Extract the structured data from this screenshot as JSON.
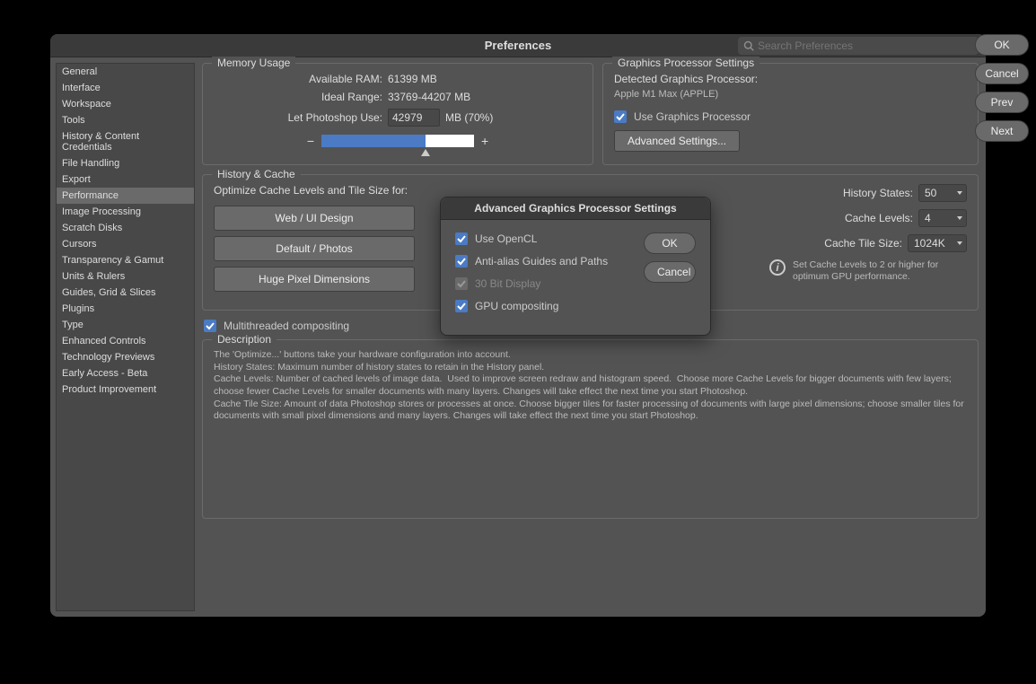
{
  "window": {
    "title": "Preferences",
    "search_placeholder": "Search Preferences"
  },
  "sidebar": {
    "items": [
      "General",
      "Interface",
      "Workspace",
      "Tools",
      "History & Content Credentials",
      "File Handling",
      "Export",
      "Performance",
      "Image Processing",
      "Scratch Disks",
      "Cursors",
      "Transparency & Gamut",
      "Units & Rulers",
      "Guides, Grid & Slices",
      "Plugins",
      "Type",
      "Enhanced Controls",
      "Technology Previews",
      "Early Access - Beta",
      "Product Improvement"
    ],
    "selected_index": 7
  },
  "buttons": {
    "ok": "OK",
    "cancel": "Cancel",
    "prev": "Prev",
    "next": "Next"
  },
  "memory": {
    "title": "Memory Usage",
    "available_label": "Available RAM:",
    "available_value": "61399 MB",
    "ideal_label": "Ideal Range:",
    "ideal_value": "33769-44207 MB",
    "use_label": "Let Photoshop Use:",
    "use_value": "42979",
    "use_suffix": "MB (70%)",
    "minus": "−",
    "plus": "+"
  },
  "gpu": {
    "title": "Graphics Processor Settings",
    "detected_label": "Detected Graphics Processor:",
    "detected_value": "Apple M1 Max (APPLE)",
    "use_gpu": "Use Graphics Processor",
    "advanced_btn": "Advanced Settings..."
  },
  "history": {
    "title": "History & Cache",
    "optimize_label": "Optimize Cache Levels and Tile Size for:",
    "btn_web": "Web / UI Design",
    "btn_default": "Default / Photos",
    "btn_huge": "Huge Pixel Dimensions",
    "history_states_label": "History States:",
    "history_states_value": "50",
    "cache_levels_label": "Cache Levels:",
    "cache_levels_value": "4",
    "cache_tile_label": "Cache Tile Size:",
    "cache_tile_value": "1024K",
    "info": "Set Cache Levels to 2 or higher for optimum GPU performance."
  },
  "multithread": "Multithreaded compositing",
  "description": {
    "title": "Description",
    "text": "The 'Optimize...' buttons take your hardware configuration into account.\nHistory States: Maximum number of history states to retain in the History panel.\nCache Levels: Number of cached levels of image data.  Used to improve screen redraw and histogram speed.  Choose more Cache Levels for bigger documents with few layers; choose fewer Cache Levels for smaller documents with many layers. Changes will take effect the next time you start Photoshop.\nCache Tile Size: Amount of data Photoshop stores or processes at once. Choose bigger tiles for faster processing of documents with large pixel dimensions; choose smaller tiles for documents with small pixel dimensions and many layers. Changes will take effect the next time you start Photoshop."
  },
  "modal": {
    "title": "Advanced Graphics Processor Settings",
    "use_opencl": "Use OpenCL",
    "antialias": "Anti-alias Guides and Paths",
    "bit30": "30 Bit Display",
    "gpu_comp": "GPU compositing",
    "ok": "OK",
    "cancel": "Cancel"
  }
}
